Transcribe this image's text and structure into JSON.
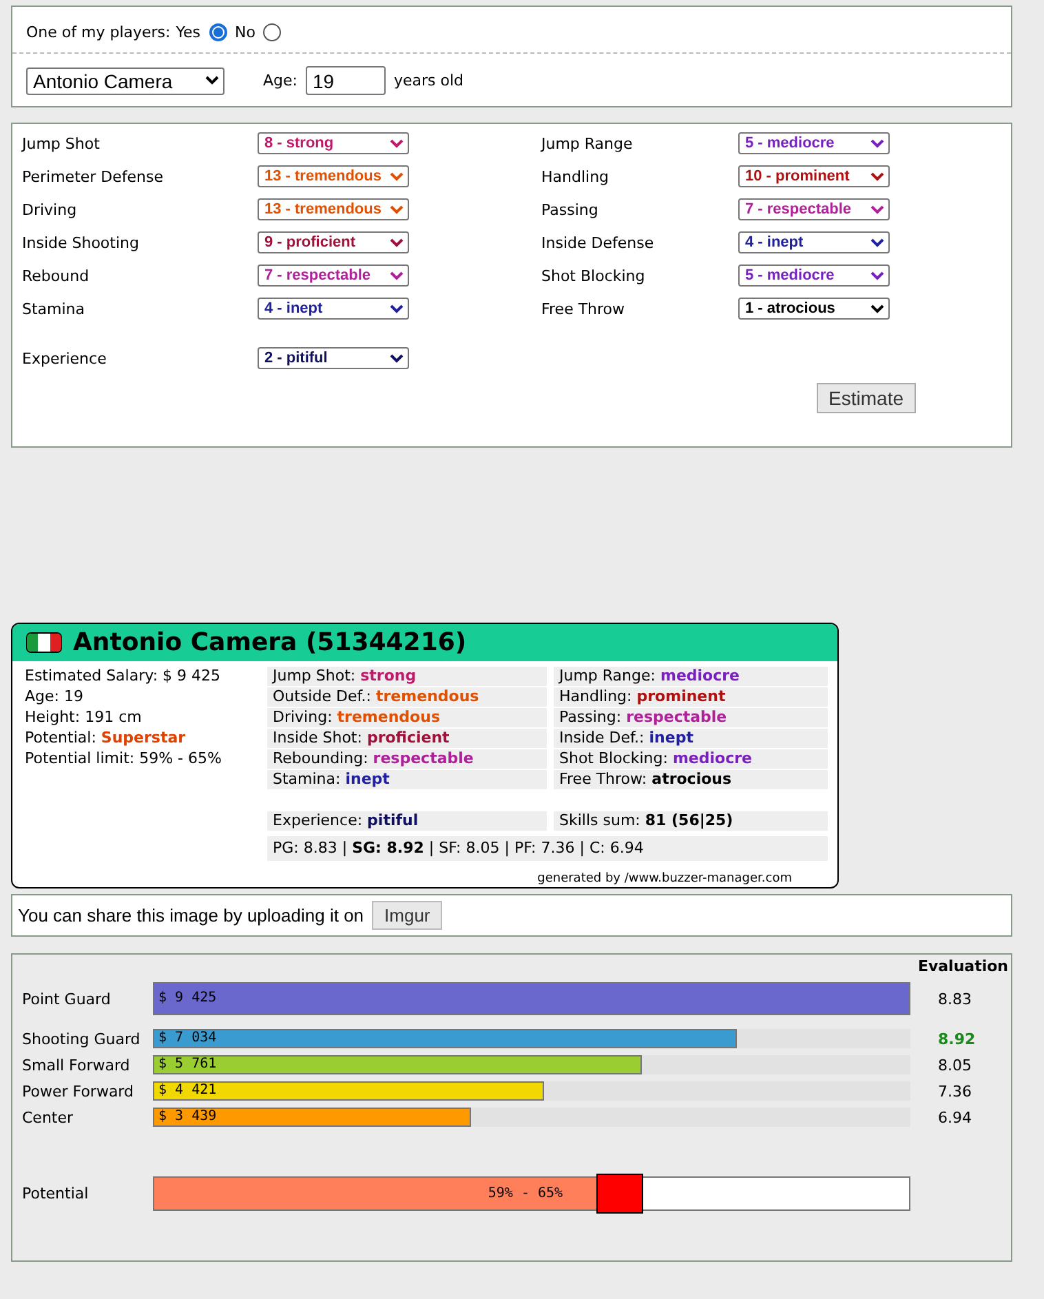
{
  "owner": {
    "label": "One of my players:",
    "options": [
      {
        "label": "Yes",
        "selected": true
      },
      {
        "label": "No",
        "selected": false
      }
    ]
  },
  "player_select": {
    "value": "Antonio Camera"
  },
  "age": {
    "label": "Age:",
    "value": "19",
    "unit": "years old"
  },
  "skills": [
    {
      "label": "Jump Shot",
      "value": "8 - strong",
      "color": "#c0186a"
    },
    {
      "label": "Jump Range",
      "value": "5 - mediocre",
      "color": "#7a1fc0"
    },
    {
      "label": "Perimeter Defense",
      "value": "13 - tremendous",
      "color": "#e05000"
    },
    {
      "label": "Handling",
      "value": "10 - prominent",
      "color": "#b01010"
    },
    {
      "label": "Driving",
      "value": "13 - tremendous",
      "color": "#e05000"
    },
    {
      "label": "Passing",
      "value": "7 - respectable",
      "color": "#b0209a"
    },
    {
      "label": "Inside Shooting",
      "value": "9 - proficient",
      "color": "#a0103a"
    },
    {
      "label": "Inside Defense",
      "value": "4 - inept",
      "color": "#2020a0"
    },
    {
      "label": "Rebound",
      "value": "7 - respectable",
      "color": "#b0209a"
    },
    {
      "label": "Shot Blocking",
      "value": "5 - mediocre",
      "color": "#7a1fc0"
    },
    {
      "label": "Stamina",
      "value": "4 - inept",
      "color": "#2020a0"
    },
    {
      "label": "Free Throw",
      "value": "1 - atrocious",
      "color": "#000000"
    }
  ],
  "experience": {
    "label": "Experience",
    "value": "2 - pitiful",
    "color": "#101060"
  },
  "estimate_button": "Estimate",
  "card": {
    "title": "Antonio Camera (51344216)",
    "info": [
      {
        "label": "Estimated Salary:",
        "value": "$ 9 425"
      },
      {
        "label": "Age:",
        "value": "19"
      },
      {
        "label": "Height:",
        "value": "191 cm"
      },
      {
        "label": "Potential:",
        "value": "Superstar",
        "color": "#e04000"
      },
      {
        "label": "Potential limit:",
        "value": " 59% - 65%"
      }
    ],
    "stats": [
      {
        "label": "Jump Shot:",
        "value": "strong",
        "color": "#c0186a"
      },
      {
        "label": "Jump Range:",
        "value": "mediocre",
        "color": "#7a1fc0"
      },
      {
        "label": "Outside Def.:",
        "value": "tremendous",
        "color": "#e05000"
      },
      {
        "label": "Handling:",
        "value": "prominent",
        "color": "#b01010"
      },
      {
        "label": "Driving:",
        "value": "tremendous",
        "color": "#e05000"
      },
      {
        "label": "Passing:",
        "value": "respectable",
        "color": "#b0209a"
      },
      {
        "label": "Inside Shot:",
        "value": "proficient",
        "color": "#a0103a"
      },
      {
        "label": "Inside Def.:",
        "value": "inept",
        "color": "#2020a0"
      },
      {
        "label": "Rebounding:",
        "value": "respectable",
        "color": "#b0209a"
      },
      {
        "label": "Shot Blocking:",
        "value": "mediocre",
        "color": "#7a1fc0"
      },
      {
        "label": "Stamina:",
        "value": "inept",
        "color": "#2020a0"
      },
      {
        "label": "Free Throw:",
        "value": "atrocious",
        "color": "#000000"
      }
    ],
    "experience": {
      "label": "Experience:",
      "value": "pitiful",
      "color": "#101060"
    },
    "skills_sum": {
      "label": "Skills sum:",
      "value": "81 (56|25)"
    },
    "ratings": "PG: 8.83 | **SG: 8.92** | SF: 8.05 | PF: 7.36 | C: 6.94",
    "footer": "generated by /www.buzzer-manager.com"
  },
  "share": {
    "text": "You can share this image by uploading it on",
    "button": "Imgur"
  },
  "evaluation": {
    "header": "Evaluation",
    "positions": [
      {
        "label": "Point Guard",
        "salary": "$ 9 425",
        "level": 1.0,
        "color": "#6a68cc",
        "evaluation": "8.83",
        "best": false
      },
      {
        "label": "Shooting Guard",
        "salary": "$ 7 034",
        "level": 0.77,
        "color": "#3a9bd0",
        "evaluation": "8.92",
        "best": true
      },
      {
        "label": "Small Forward",
        "salary": "$ 5 761",
        "level": 0.645,
        "color": "#9acd32",
        "evaluation": "8.05",
        "best": false
      },
      {
        "label": "Power Forward",
        "salary": "$ 4 421",
        "level": 0.516,
        "color": "#f0d800",
        "evaluation": "7.36",
        "best": false
      },
      {
        "label": "Center",
        "salary": "$ 3 439",
        "level": 0.42,
        "color": "#ff9900",
        "evaluation": "6.94",
        "best": false
      }
    ],
    "potential": {
      "label": "Potential",
      "text": "59% - 65%",
      "level": 0.585,
      "limit": {
        "level": 0.647
      }
    }
  }
}
